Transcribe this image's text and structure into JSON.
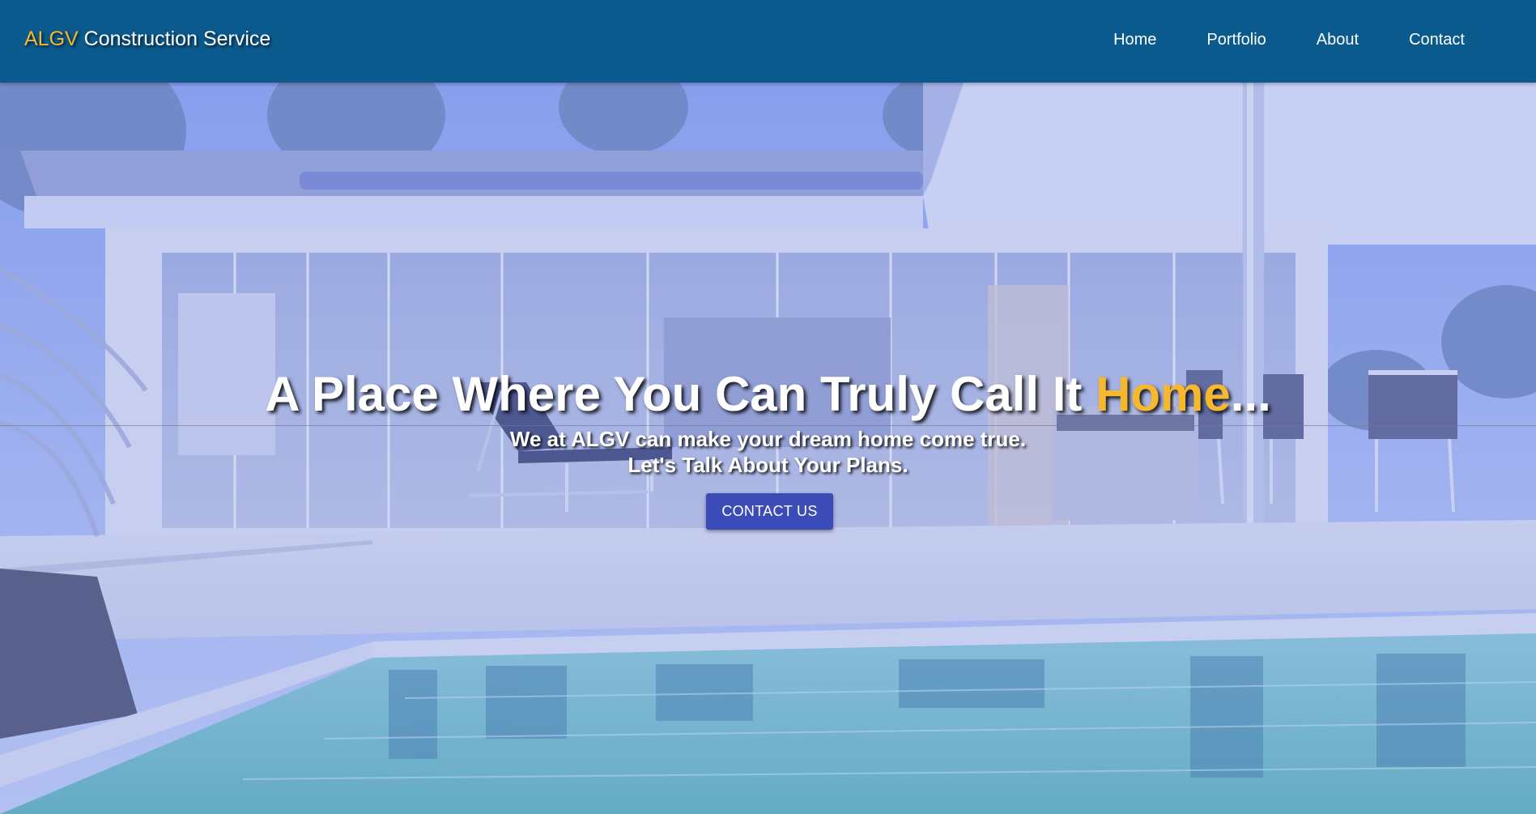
{
  "brand": {
    "accent": "ALGV",
    "rest": " Construction Service"
  },
  "nav": {
    "items": [
      "Home",
      "Portfolio",
      "About",
      "Contact"
    ]
  },
  "hero": {
    "headline_main": "A Place Where You Can Truly Call It ",
    "headline_accent": "Home",
    "headline_suffix": "...",
    "subline_1": "We at ALGV can make your dream home come true.",
    "subline_2": "Let's Talk About Your Plans.",
    "cta_label": "CONTACT US"
  },
  "colors": {
    "navbar": "#0a5a8e",
    "accent": "#f5b82e",
    "cta": "#3b4cb8",
    "text": "#ffffff"
  },
  "icons": {
    "hero_image": "modern-house-pool-photo"
  }
}
